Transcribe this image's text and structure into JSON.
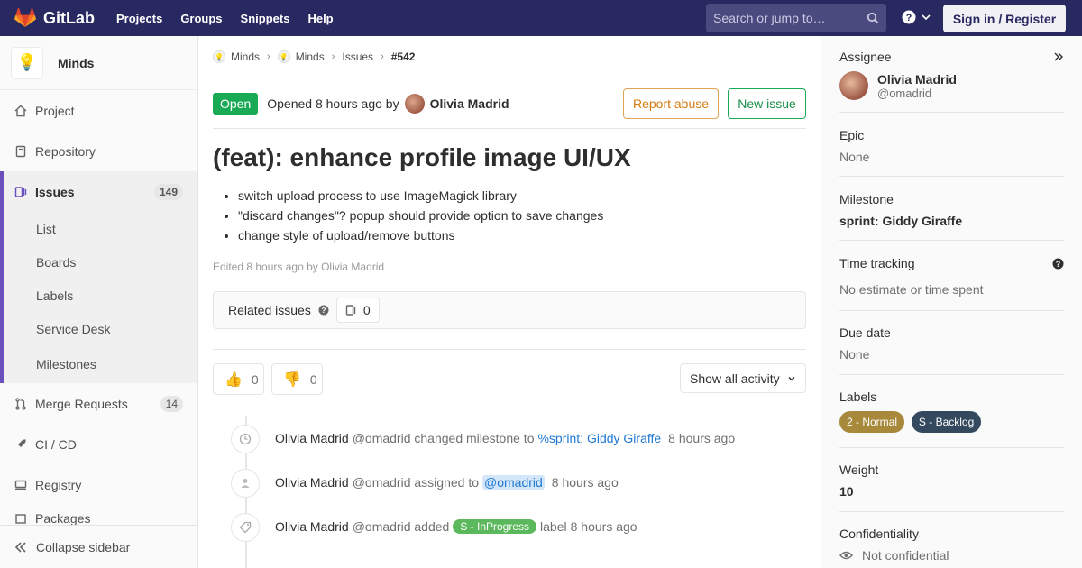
{
  "navbar": {
    "brand": "GitLab",
    "links": [
      "Projects",
      "Groups",
      "Snippets",
      "Help"
    ],
    "search_placeholder": "Search or jump to…",
    "signin": "Sign in / Register"
  },
  "sidebar": {
    "project_name": "Minds",
    "items": [
      {
        "label": "Project",
        "icon": "home-icon"
      },
      {
        "label": "Repository",
        "icon": "book-icon"
      },
      {
        "label": "Issues",
        "icon": "issues-icon",
        "count": "149"
      },
      {
        "label": "Merge Requests",
        "icon": "merge-request-icon",
        "count": "14"
      },
      {
        "label": "CI / CD",
        "icon": "rocket-icon"
      },
      {
        "label": "Registry",
        "icon": "disk-icon"
      }
    ],
    "issue_subitems": [
      "List",
      "Boards",
      "Labels",
      "Service Desk",
      "Milestones"
    ],
    "partial_item": "Packages",
    "collapse": "Collapse sidebar"
  },
  "breadcrumb": [
    "Minds",
    "Minds",
    "Issues",
    "#542"
  ],
  "issue": {
    "status": "Open",
    "opened_text": "Opened 8 hours ago by",
    "author": "Olivia Madrid",
    "report_abuse": "Report abuse",
    "new_issue": "New issue",
    "title": "(feat): enhance profile image UI/UX",
    "description": [
      "switch upload process to use ImageMagick library",
      "\"discard changes\"? popup should provide option to save changes",
      "change style of upload/remove buttons"
    ],
    "edited": "Edited 8 hours ago by Olivia Madrid",
    "related_label": "Related issues",
    "related_count": "0",
    "thumbs_up": "0",
    "thumbs_down": "0",
    "activity_filter": "Show all activity"
  },
  "timeline": [
    {
      "name": "Olivia Madrid",
      "handle": "@omadrid",
      "action": "changed milestone to",
      "link": "%sprint: Giddy Giraffe",
      "time": "8 hours ago"
    },
    {
      "name": "Olivia Madrid",
      "handle": "@omadrid",
      "action": "assigned to",
      "mention": "@omadrid",
      "time": "8 hours ago"
    },
    {
      "name": "Olivia Madrid",
      "handle": "@omadrid",
      "action": "added",
      "label": "S - InProgress",
      "after": "label",
      "time": "8 hours ago"
    }
  ],
  "right_sidebar": {
    "assignee_title": "Assignee",
    "assignee_name": "Olivia Madrid",
    "assignee_username": "@omadrid",
    "epic_title": "Epic",
    "epic_value": "None",
    "milestone_title": "Milestone",
    "milestone_value": "sprint: Giddy Giraffe",
    "time_title": "Time tracking",
    "time_value": "No estimate or time spent",
    "due_title": "Due date",
    "due_value": "None",
    "labels_title": "Labels",
    "labels": [
      {
        "text": "2 - Normal",
        "color": "#a8883a"
      },
      {
        "text": "S - Backlog",
        "color": "#34495e"
      }
    ],
    "weight_title": "Weight",
    "weight_value": "10",
    "conf_title": "Confidentiality",
    "conf_value": "Not confidential"
  },
  "colors": {
    "navbar": "#292961",
    "open_green": "#1aaa55",
    "active_accent": "#6b4fbb",
    "progress_label": "#5cb85c"
  }
}
